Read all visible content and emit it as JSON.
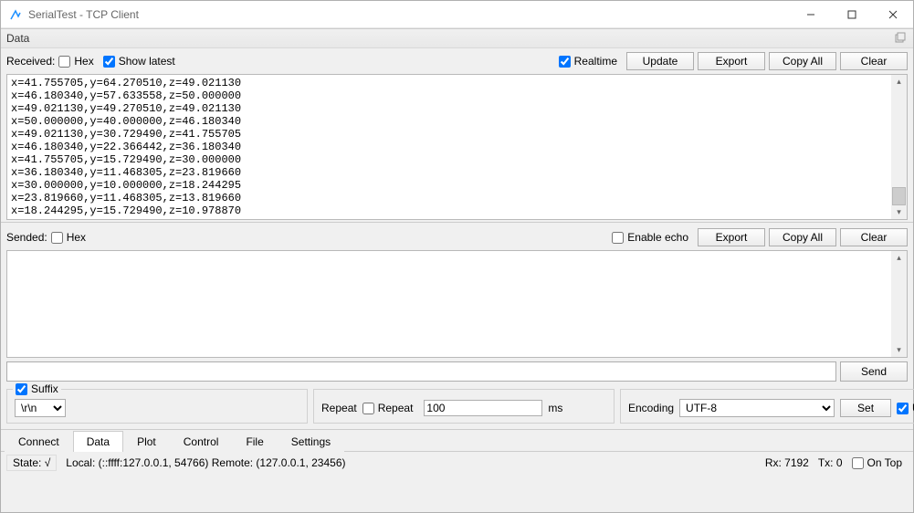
{
  "window": {
    "title": "SerialTest - TCP Client"
  },
  "panel": {
    "title": "Data"
  },
  "received": {
    "label": "Received:",
    "hex_label": "Hex",
    "show_latest_label": "Show latest",
    "realtime_label": "Realtime",
    "update_label": "Update",
    "export_label": "Export",
    "copy_label": "Copy All",
    "clear_label": "Clear",
    "lines": [
      "x=41.755705,y=64.270510,z=49.021130",
      "x=46.180340,y=57.633558,z=50.000000",
      "x=49.021130,y=49.270510,z=49.021130",
      "x=50.000000,y=40.000000,z=46.180340",
      "x=49.021130,y=30.729490,z=41.755705",
      "x=46.180340,y=22.366442,z=36.180340",
      "x=41.755705,y=15.729490,z=30.000000",
      "x=36.180340,y=11.468305,z=23.819660",
      "x=30.000000,y=10.000000,z=18.244295",
      "x=23.819660,y=11.468305,z=13.819660",
      "x=18.244295,y=15.729490,z=10.978870"
    ]
  },
  "sended": {
    "label": "Sended:",
    "hex_label": "Hex",
    "echo_label": "Enable echo",
    "export_label": "Export",
    "copy_label": "Copy All",
    "clear_label": "Clear"
  },
  "send": {
    "button": "Send"
  },
  "suffix": {
    "legend": "Suffix",
    "checkbox_label": "Suffix",
    "value": "\\r\\n"
  },
  "repeat": {
    "legend": "Repeat",
    "checkbox_label": "Repeat",
    "value": "100",
    "unit": "ms"
  },
  "encoding": {
    "legend": "Encoding",
    "value": "UTF-8",
    "set_label": "Set",
    "unescape_label": "Unescape"
  },
  "tabs": {
    "items": [
      "Connect",
      "Data",
      "Plot",
      "Control",
      "File",
      "Settings"
    ],
    "active": 1
  },
  "status": {
    "state_label": "State: √",
    "local_label": "Local: (::ffff:127.0.0.1, 54766) Remote: (127.0.0.1, 23456)",
    "rx_label": "Rx: 7192",
    "tx_label": "Tx: 0",
    "ontop_label": "On Top"
  }
}
